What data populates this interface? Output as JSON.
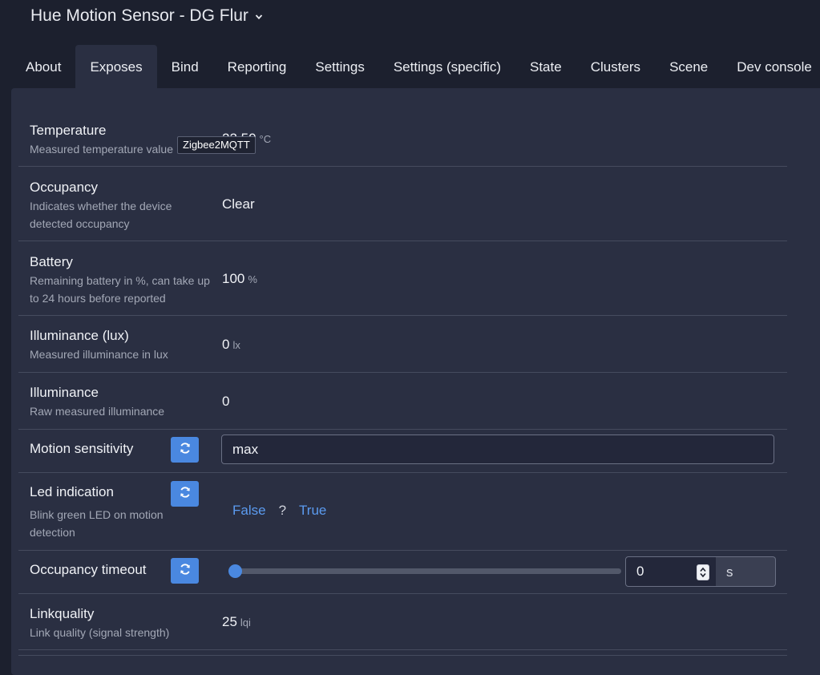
{
  "header": {
    "title": "Hue Motion Sensor - DG Flur"
  },
  "tabs": [
    "About",
    "Exposes",
    "Bind",
    "Reporting",
    "Settings",
    "Settings (specific)",
    "State",
    "Clusters",
    "Scene",
    "Dev console"
  ],
  "active_tab": "Exposes",
  "tooltip": "Zigbee2MQTT",
  "exposes": {
    "temperature": {
      "name": "Temperature",
      "desc": "Measured temperature value",
      "value": "22.50",
      "unit": "°C"
    },
    "occupancy": {
      "name": "Occupancy",
      "desc": "Indicates whether the device detected occupancy",
      "value": "Clear"
    },
    "battery": {
      "name": "Battery",
      "desc": "Remaining battery in %, can take up to 24 hours before reported",
      "value": "100",
      "unit": "%"
    },
    "illuminance_lux": {
      "name": "Illuminance (lux)",
      "desc": "Measured illuminance in lux",
      "value": "0",
      "unit": "lx"
    },
    "illuminance": {
      "name": "Illuminance",
      "desc": "Raw measured illuminance",
      "value": "0"
    },
    "motion_sensitivity": {
      "name": "Motion sensitivity",
      "value": "max"
    },
    "led_indication": {
      "name": "Led indication",
      "desc": "Blink green LED on motion detection",
      "false_label": "False",
      "separator": "?",
      "true_label": "True"
    },
    "occupancy_timeout": {
      "name": "Occupancy timeout",
      "value": "0",
      "unit": "s",
      "slider_fraction": 0
    },
    "linkquality": {
      "name": "Linkquality",
      "desc": "Link quality (signal strength)",
      "value": "25",
      "unit": "lqi"
    }
  },
  "colors": {
    "accent": "#4a88e0",
    "link": "#5b9bf0",
    "panel": "#2a2f42",
    "background": "#1c202e"
  },
  "icons": {
    "title_dropdown": "chevron-down-icon",
    "refresh": "refresh-icon",
    "spinner": "spinner-arrows-icon"
  }
}
